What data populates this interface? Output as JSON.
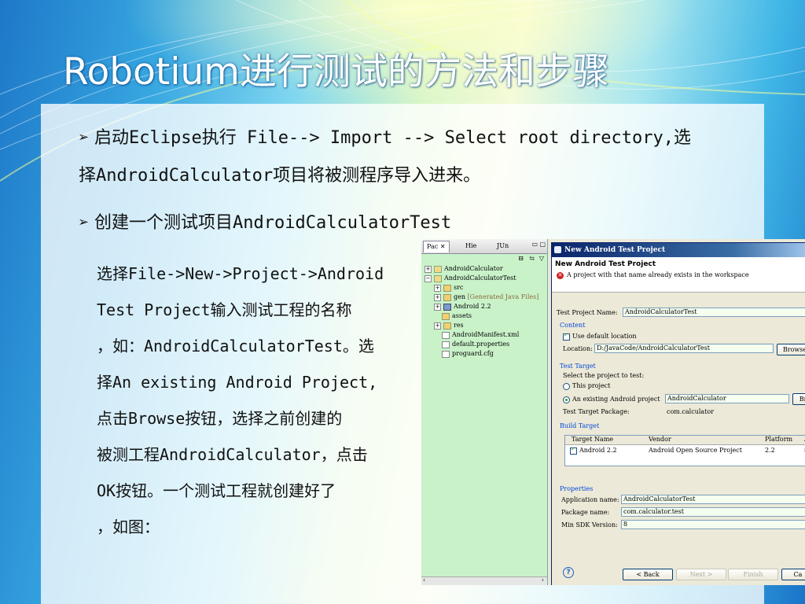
{
  "slide": {
    "title": "Robotium进行测试的方法和步骤",
    "bullets": [
      {
        "marker": "➢",
        "text_line1": "启动Eclipse执行 File--> Import --> Select root directory,选",
        "text_line2": "择AndroidCalculator项目将被测程序导入进来。"
      },
      {
        "marker": "➢",
        "text_line1": "创建一个测试项目AndroidCalculatorTest"
      }
    ],
    "description_lines": [
      "选择File->New->Project->Android",
      "Test Project输入测试工程的名称",
      "，如：AndroidCalculatorTest。选",
      "择An existing Android Project,",
      "点击Browse按钮，选择之前创建的",
      "被测工程AndroidCalculator，点击",
      "OK按钮。一个测试工程就创建好了",
      "，如图："
    ]
  },
  "explorer": {
    "tabs": [
      "Pac",
      "Hie",
      "JUn"
    ],
    "tree": [
      {
        "label": "AndroidCalculator",
        "level": 0
      },
      {
        "label": "AndroidCalculatorTest",
        "level": 0
      },
      {
        "label": "src",
        "level": 1
      },
      {
        "label": "gen",
        "decoration": "[Generated Java Files]",
        "level": 1
      },
      {
        "label": "Android 2.2",
        "level": 1
      },
      {
        "label": "assets",
        "level": 1
      },
      {
        "label": "res",
        "level": 1
      },
      {
        "label": "AndroidManifest.xml",
        "level": 1
      },
      {
        "label": "default.properties",
        "level": 1
      },
      {
        "label": "proguard.cfg",
        "level": 1
      }
    ]
  },
  "dialog": {
    "window_title": "New Android Test Project",
    "header_title": "New Android Test Project",
    "error_message": "A project with that name already exists in the workspace",
    "test_project_name_label": "Test Project Name:",
    "test_project_name_value": "AndroidCalculatorTest",
    "content_group": "Content",
    "use_default_location": "Use default location",
    "location_label": "Location:",
    "location_value": "D:/JavaCode/AndroidCalculatorTest",
    "browse_label": "Browse",
    "test_target_group": "Test Target",
    "select_project_label": "Select the project to test:",
    "this_project": "This project",
    "existing_project": "An existing Android project",
    "existing_project_value": "AndroidCalculator",
    "browse_short": "Bro",
    "test_target_package_label": "Test Target Package:",
    "test_target_package_value": "com.calculator",
    "build_target_group": "Build Target",
    "table_headers": [
      "Target Name",
      "Vendor",
      "Platform",
      "A"
    ],
    "table_rows": [
      [
        "Android 2.2",
        "Android Open Source Project",
        "2.2",
        "8"
      ]
    ],
    "properties_group": "Properties",
    "application_name_label": "Application name:",
    "application_name_value": "AndroidCalculatorTest",
    "package_name_label": "Package name:",
    "package_name_value": "com.calculator.test",
    "min_sdk_label": "Min SDK Version:",
    "min_sdk_value": "8",
    "buttons": [
      "< Back",
      "Next >",
      "Finish",
      "Ca"
    ],
    "help": "?"
  }
}
